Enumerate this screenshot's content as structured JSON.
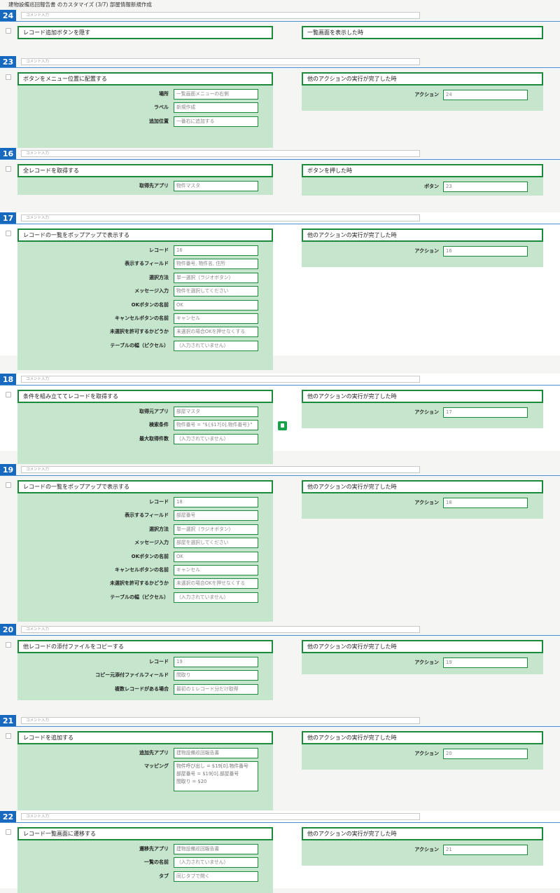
{
  "header": {
    "title": "建物設備巡回報告書 のカスタマイズ (3/7) 部屋情報新規作成"
  },
  "comment_placeholder": "コメント入力",
  "blocks": [
    {
      "num": "24",
      "action_title": "レコード追加ボタンを隠す",
      "fields": [],
      "trigger_title": "一覧画面を表示した時",
      "trigger_label": "",
      "trigger_value": ""
    },
    {
      "num": "23",
      "action_title": "ボタンをメニュー位置に配置する",
      "fields": [
        {
          "label": "場所",
          "value": "一覧画面メニューの右側"
        },
        {
          "label": "ラベル",
          "value": "新規作成"
        },
        {
          "label": "追加位置",
          "value": "一番右に追加する"
        }
      ],
      "trigger_title": "他のアクションの実行が完了した時",
      "trigger_label": "アクション",
      "trigger_value": "24"
    },
    {
      "num": "16",
      "action_title": "全レコードを取得する",
      "fields": [
        {
          "label": "取得先アプリ",
          "value": "物件マスタ"
        }
      ],
      "trigger_title": "ボタンを押した時",
      "trigger_label": "ボタン",
      "trigger_value": "23"
    },
    {
      "num": "17",
      "action_title": "レコードの一覧をポップアップで表示する",
      "fields": [
        {
          "label": "レコード",
          "value": "16"
        },
        {
          "label": "表示するフィールド",
          "value": "物件番号, 物件名, 住所"
        },
        {
          "label": "選択方法",
          "value": "単一選択（ラジオボタン）"
        },
        {
          "label": "メッセージ入力",
          "value": "物件を選択してください"
        },
        {
          "label": "OKボタンの名前",
          "value": "OK"
        },
        {
          "label": "キャンセルボタンの名前",
          "value": "キャンセル"
        },
        {
          "label": "未選択を許可するかどうか",
          "value": "未選択の場合OKを押せなくする"
        },
        {
          "label": "テーブルの幅（ピクセル）",
          "value": "（入力されていません）"
        }
      ],
      "trigger_title": "他のアクションの実行が完了した時",
      "trigger_label": "アクション",
      "trigger_value": "16"
    },
    {
      "num": "18",
      "action_title": "条件を組み立ててレコードを取得する",
      "fields": [
        {
          "label": "取得元アプリ",
          "value": "部屋マスタ"
        },
        {
          "label": "検索条件",
          "value": "物件番号 = \"${$17[0].物件番号}\""
        },
        {
          "label": "最大取得件数",
          "value": "（入力されていません）"
        }
      ],
      "trigger_title": "他のアクションの実行が完了した時",
      "trigger_label": "アクション",
      "trigger_value": "17"
    },
    {
      "num": "19",
      "action_title": "レコードの一覧をポップアップで表示する",
      "fields": [
        {
          "label": "レコード",
          "value": "18"
        },
        {
          "label": "表示するフィールド",
          "value": "部屋番号"
        },
        {
          "label": "選択方法",
          "value": "単一選択（ラジオボタン）"
        },
        {
          "label": "メッセージ入力",
          "value": "部屋を選択してください"
        },
        {
          "label": "OKボタンの名前",
          "value": "OK"
        },
        {
          "label": "キャンセルボタンの名前",
          "value": "キャンセル"
        },
        {
          "label": "未選択を許可するかどうか",
          "value": "未選択の場合OKを押せなくする"
        },
        {
          "label": "テーブルの幅（ピクセル）",
          "value": "（入力されていません）"
        }
      ],
      "trigger_title": "他のアクションの実行が完了した時",
      "trigger_label": "アクション",
      "trigger_value": "18"
    },
    {
      "num": "20",
      "action_title": "他レコードの添付ファイルをコピーする",
      "fields": [
        {
          "label": "レコード",
          "value": "19"
        },
        {
          "label": "コピー元添付ファイルフィールド",
          "value": "間取り"
        },
        {
          "label": "複数レコードがある場合",
          "value": "最初の１レコード分だけ取得"
        }
      ],
      "trigger_title": "他のアクションの実行が完了した時",
      "trigger_label": "アクション",
      "trigger_value": "19"
    },
    {
      "num": "21",
      "action_title": "レコードを追加する",
      "fields": [
        {
          "label": "追加先アプリ",
          "value": "建物設備巡回報告書"
        },
        {
          "label": "マッピング",
          "value": "物件呼び出し = $19[0].物件番号\n部屋番号 = $19[0].部屋番号\n間取り = $20"
        }
      ],
      "trigger_title": "他のアクションの実行が完了した時",
      "trigger_label": "アクション",
      "trigger_value": "20"
    },
    {
      "num": "22",
      "action_title": "レコード一覧画面に遷移する",
      "fields": [
        {
          "label": "遷移先アプリ",
          "value": "建物設備巡回報告書"
        },
        {
          "label": "一覧の名前",
          "value": "（入力されていません）"
        },
        {
          "label": "タブ",
          "value": "同じタブで開く"
        }
      ],
      "trigger_title": "他のアクションの実行が完了した時",
      "trigger_label": "アクション",
      "trigger_value": "21"
    }
  ]
}
